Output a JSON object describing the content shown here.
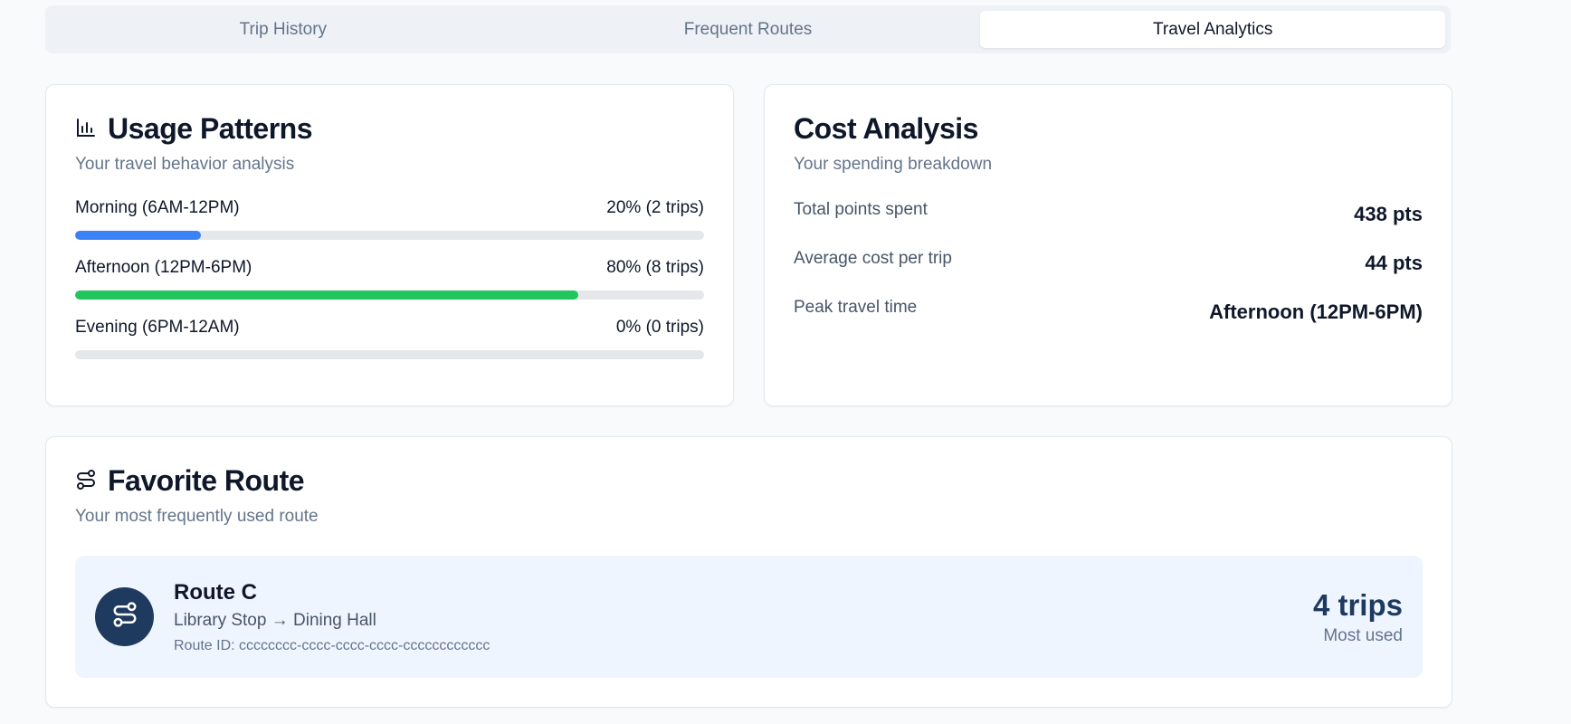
{
  "tabs": [
    {
      "label": "Trip History",
      "active": false
    },
    {
      "label": "Frequent Routes",
      "active": false
    },
    {
      "label": "Travel Analytics",
      "active": true
    }
  ],
  "usage": {
    "title": "Usage Patterns",
    "subtitle": "Your travel behavior analysis",
    "icon": "bar-chart-icon",
    "rows": [
      {
        "label": "Morning (6AM-12PM)",
        "value": "20% (2 trips)",
        "percent": 20,
        "color": "#3b82f6"
      },
      {
        "label": "Afternoon (12PM-6PM)",
        "value": "80% (8 trips)",
        "percent": 80,
        "color": "#22c55e"
      },
      {
        "label": "Evening (6PM-12AM)",
        "value": "0% (0 trips)",
        "percent": 0,
        "color": "#f97316"
      }
    ]
  },
  "cost": {
    "title": "Cost Analysis",
    "subtitle": "Your spending breakdown",
    "rows": [
      {
        "label": "Total points spent",
        "value": "438 pts"
      },
      {
        "label": "Average cost per trip",
        "value": "44 pts"
      },
      {
        "label": "Peak travel time",
        "value": "Afternoon (12PM-6PM)"
      }
    ]
  },
  "favorite": {
    "title": "Favorite Route",
    "subtitle": "Your most frequently used route",
    "icon": "route-icon",
    "route_name": "Route C",
    "route_path": "Library Stop → Dining Hall",
    "route_id": "Route ID: cccccccc-cccc-cccc-cccc-cccccccccccc",
    "trips": "4 trips",
    "trips_label": "Most used"
  },
  "colors": {
    "accent_dark": "#1e3a5f",
    "morning_bar": "#3b82f6",
    "afternoon_bar": "#22c55e"
  }
}
